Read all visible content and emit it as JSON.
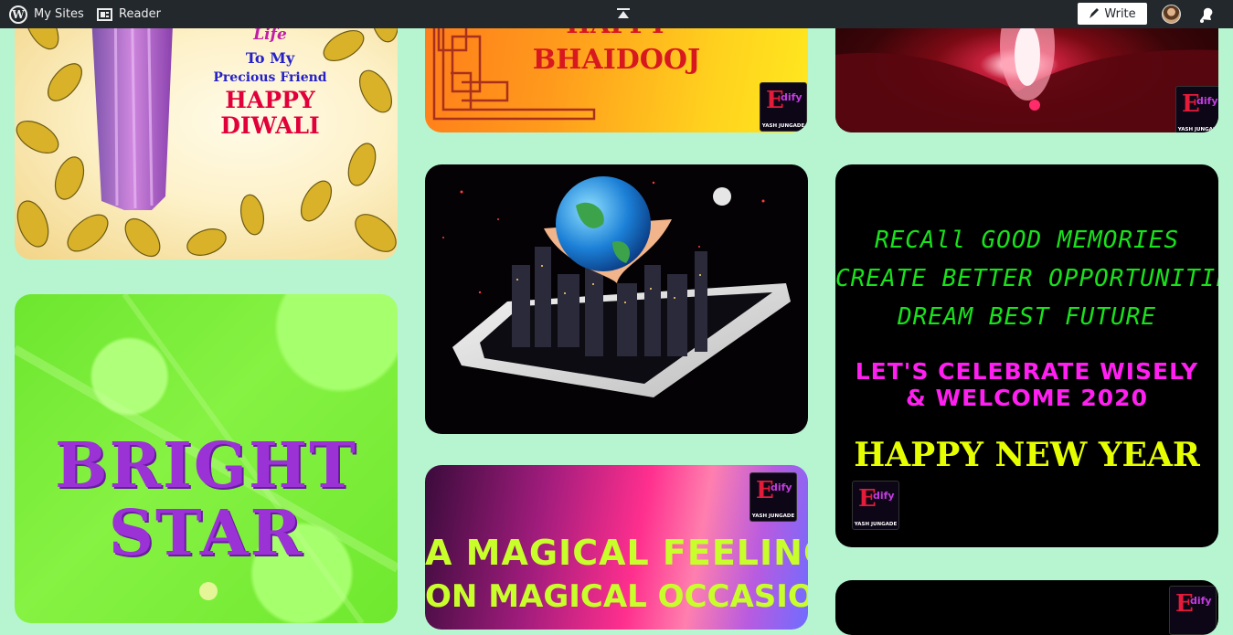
{
  "topbar": {
    "my_sites_label": "My Sites",
    "reader_label": "Reader",
    "write_label": "Write"
  },
  "cards": {
    "diwali": {
      "line1": "Life",
      "line2": "To My",
      "line3": "Precious Friend",
      "line4": "HAPPY",
      "line5": "DIWALI"
    },
    "bright_star": {
      "line1": "BRIGHT",
      "line2": "STAR"
    },
    "bhaidooj": {
      "line1": "HAPPY",
      "line2": "BHAIDOOJ"
    },
    "magical": {
      "line1": "A MAGICAL FEELING",
      "line2": "ON MAGICAL OCCASION"
    },
    "new_year": {
      "line1": "RECAll GOOD MEMORIES",
      "line2": "CREATE BETTER OPPORTUNITIES",
      "line3": "DREAM BEST FUTURE",
      "line4": "LET'S CELEBRATE WISELY",
      "line5": "& WELCOME 2020",
      "line6": "HAPPY NEW YEAR"
    }
  },
  "badge": {
    "glyph": "E",
    "script": "dify",
    "caption": "YASH JUNGADE"
  },
  "colors": {
    "background": "#b6f5d0",
    "topbar": "#23282d"
  }
}
